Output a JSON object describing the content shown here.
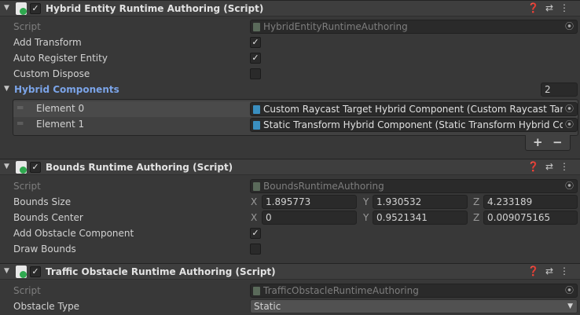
{
  "components": [
    {
      "title": "Hybrid Entity Runtime Authoring (Script)",
      "enabled": true,
      "script_label": "Script",
      "script_value": "HybridEntityRuntimeAuthoring",
      "fields": [
        {
          "label": "Add Transform",
          "checked": true
        },
        {
          "label": "Auto Register Entity",
          "checked": true
        },
        {
          "label": "Custom Dispose",
          "checked": false
        }
      ],
      "list": {
        "label": "Hybrid Components",
        "count": "2",
        "elements": [
          {
            "label": "Element 0",
            "value": "Custom Raycast Target Hybrid Component (Custom Raycast Target Hybrid Component)"
          },
          {
            "label": "Element 1",
            "value": "Static Transform Hybrid Component (Static Transform Hybrid Component)"
          }
        ],
        "add": "+",
        "remove": "−"
      }
    },
    {
      "title": "Bounds Runtime Authoring (Script)",
      "enabled": true,
      "script_label": "Script",
      "script_value": "BoundsRuntimeAuthoring",
      "bounds_size": {
        "label": "Bounds Size",
        "x": "1.895773",
        "y": "1.930532",
        "z": "4.233189"
      },
      "bounds_center": {
        "label": "Bounds Center",
        "x": "0",
        "y": "0.9521341",
        "z": "0.009075165"
      },
      "axes": {
        "x": "X",
        "y": "Y",
        "z": "Z"
      },
      "fields": [
        {
          "label": "Add Obstacle Component",
          "checked": true
        },
        {
          "label": "Draw Bounds",
          "checked": false
        }
      ]
    },
    {
      "title": "Traffic Obstacle Runtime Authoring (Script)",
      "enabled": true,
      "script_label": "Script",
      "script_value": "TrafficObstacleRuntimeAuthoring",
      "obstacle_type": {
        "label": "Obstacle Type",
        "value": "Static"
      }
    }
  ],
  "check": "✓",
  "colors": {
    "background": "#383838",
    "header": "#3e3e3e",
    "field": "#2a2a2a",
    "accent": "#7ba4e8"
  }
}
